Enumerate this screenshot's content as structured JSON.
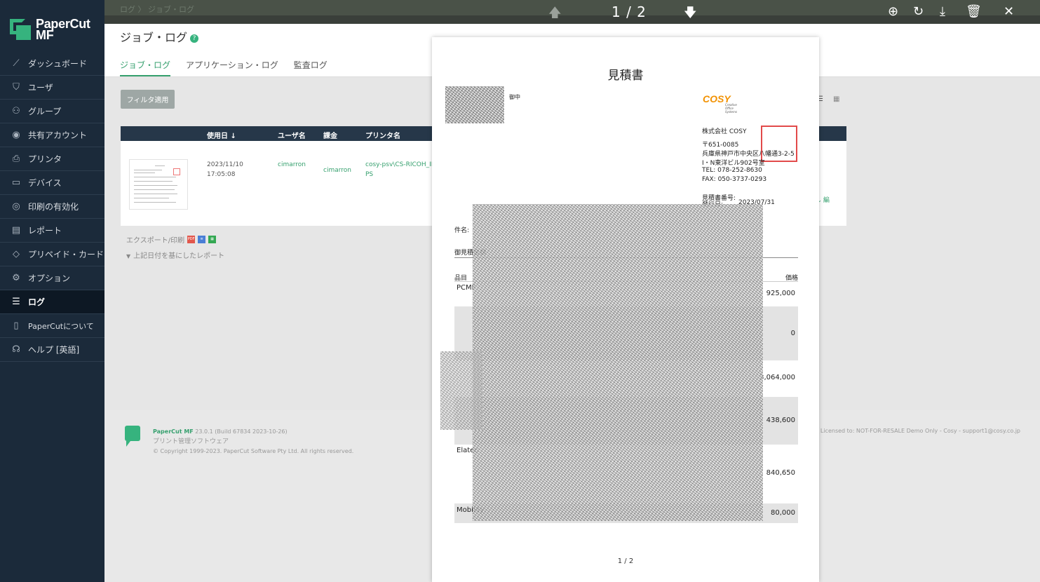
{
  "app": {
    "logo_line1": "PaperCut",
    "logo_line2": "MF"
  },
  "sidebar": {
    "items": [
      {
        "label": "ダッシュボード",
        "icon": "chart-line-icon"
      },
      {
        "label": "ユーザ",
        "icon": "shield-icon"
      },
      {
        "label": "グループ",
        "icon": "group-icon"
      },
      {
        "label": "共有アカウント",
        "icon": "account-icon"
      },
      {
        "label": "プリンタ",
        "icon": "printer-icon"
      },
      {
        "label": "デバイス",
        "icon": "device-icon"
      },
      {
        "label": "印刷の有効化",
        "icon": "release-icon"
      },
      {
        "label": "レポート",
        "icon": "clipboard-icon"
      },
      {
        "label": "プリペイド・カード",
        "icon": "tag-icon"
      },
      {
        "label": "オプション",
        "icon": "gear-icon"
      },
      {
        "label": "ログ",
        "icon": "list-icon",
        "active": true
      },
      {
        "label": "PaperCutについて",
        "icon": "book-icon"
      },
      {
        "label": "ヘルプ [英語]",
        "icon": "headset-icon"
      }
    ]
  },
  "header": {
    "breadcrumb": "ログ 〉 ジョブ・ログ",
    "title": "ジョブ・ログ",
    "help_glyph": "?",
    "tabs": [
      "ジョブ・ログ",
      "アプリケーション・ログ",
      "監査ログ"
    ]
  },
  "toolbar": {
    "filter_label": "フィルタ適用"
  },
  "table": {
    "headers": [
      "使用日 ↓",
      "ユーザ名",
      "課金",
      "プリンタ名"
    ],
    "row": {
      "date": "2023/11/10",
      "time": "17:05:08",
      "user": "cimarron",
      "charge": "cimarron",
      "printer": "cosy-psv\\CS-RICOH_IM",
      "printer_2": "PS",
      "edit": "し 編"
    }
  },
  "export": {
    "label": "エクスポート/印刷",
    "report_link": "上記日付を基にしたレポート"
  },
  "footer": {
    "brand": "PaperCut MF",
    "version": "23.0.1 (Build 67834 2023-10-26)",
    "tagline": "プリント管理ソフトウェア",
    "copyright": "© Copyright 1999-2023. PaperCut Software Pty Ltd. All rights reserved.",
    "license": "Licensed to: NOT-FOR-RESALE Demo Only - Cosy - support1@cosy.co.jp"
  },
  "viewer": {
    "pager": "1 / 2",
    "doc": {
      "title": "見積書",
      "to_suffix": "御中",
      "company_logo": "COSY",
      "company_logo_sub": "Creative\nOffice\nSystems",
      "company": "株式会社 COSY",
      "postal": "〒651-0085",
      "address1": "兵庫県神戸市中央区八幡通3-2-5",
      "address2": "I・N東洋ビル902号室",
      "tel": "TEL: 078-252-8630",
      "fax": "FAX: 050-3737-0293",
      "quote_no_label": "見積書番号:",
      "issue_label": "発行日:",
      "issue_date": "2023/07/31",
      "subject_label": "件名:",
      "total_label": "御見積金額",
      "col_item": "品目",
      "col_price": "価格",
      "item1": "PCMF",
      "item_elatec": "Elatec",
      "item_mobility": "Mobility",
      "prices": [
        "925,000",
        "0",
        "3,064,000",
        "438,600",
        "840,650",
        "80,000"
      ],
      "page": "1 / 2"
    }
  }
}
